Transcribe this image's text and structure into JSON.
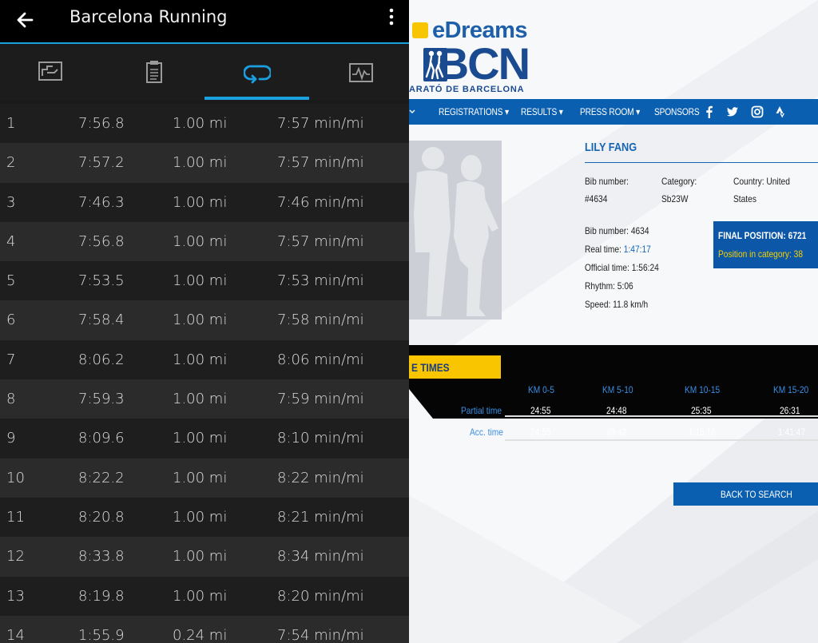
{
  "garmin": {
    "title": "Barcelona Running",
    "tabs": [
      {
        "icon": "chart-icon"
      },
      {
        "icon": "document-icon"
      },
      {
        "icon": "laps-icon",
        "selected": true
      },
      {
        "icon": "activity-graph-icon"
      }
    ],
    "laps": [
      {
        "num": "1",
        "time": "7:56.8",
        "distance": "1.00 mi",
        "pace": "7:57 min/mi"
      },
      {
        "num": "2",
        "time": "7:57.2",
        "distance": "1.00 mi",
        "pace": "7:57 min/mi"
      },
      {
        "num": "3",
        "time": "7:46.3",
        "distance": "1.00 mi",
        "pace": "7:46 min/mi"
      },
      {
        "num": "4",
        "time": "7:56.8",
        "distance": "1.00 mi",
        "pace": "7:57 min/mi"
      },
      {
        "num": "5",
        "time": "7:53.5",
        "distance": "1.00 mi",
        "pace": "7:53 min/mi"
      },
      {
        "num": "6",
        "time": "7:58.4",
        "distance": "1.00 mi",
        "pace": "7:58 min/mi"
      },
      {
        "num": "7",
        "time": "8:06.2",
        "distance": "1.00 mi",
        "pace": "8:06 min/mi"
      },
      {
        "num": "8",
        "time": "7:59.3",
        "distance": "1.00 mi",
        "pace": "7:59 min/mi"
      },
      {
        "num": "9",
        "time": "8:09.6",
        "distance": "1.00 mi",
        "pace": "8:10 min/mi"
      },
      {
        "num": "10",
        "time": "8:22.2",
        "distance": "1.00 mi",
        "pace": "8:22 min/mi"
      },
      {
        "num": "11",
        "time": "8:20.8",
        "distance": "1.00 mi",
        "pace": "8:21 min/mi"
      },
      {
        "num": "12",
        "time": "8:33.8",
        "distance": "1.00 mi",
        "pace": "8:34 min/mi"
      },
      {
        "num": "13",
        "time": "8:19.8",
        "distance": "1.00 mi",
        "pace": "8:20 min/mi"
      },
      {
        "num": "14",
        "time": "1:55.9",
        "distance": "0.24 mi",
        "pace": "7:54 min/mi"
      }
    ],
    "colors": {
      "accent": "#1aa0e0"
    }
  },
  "results": {
    "brand": "eDreams",
    "logo": "BCN",
    "logo_sub": "ARATÓ DE BARCELONA",
    "nav": [
      "REGISTRATIONS",
      "RESULTS",
      "PRESS ROOM",
      "SPONSORS"
    ],
    "runner": {
      "name": "LILY FANG",
      "bib_label": "Bib number:",
      "bib_value": "#4634",
      "category_label": "Category:",
      "category_value": "Sb23W",
      "country_line1": "Country: United",
      "country_line2": "States",
      "bib_number_line": "Bib number: 4634",
      "real_time_label": "Real time:",
      "real_time": "1:47:17",
      "official_time": "Official time: 1:56:24",
      "rhythm": "Rhythm: 5:06",
      "speed": "Speed: 11.8 km/h"
    },
    "final_position": "FINAL POSITION: 6721",
    "category_position": "Position in category: 38",
    "times_label": "E TIMES",
    "splits": {
      "headers": [
        "KM 0-5",
        "KM 5-10",
        "KM 10-15",
        "KM 15-20"
      ],
      "partial_label": "Partial time",
      "partial": [
        "24:55",
        "24:48",
        "25:35",
        "26:31"
      ],
      "acc_label": "Acc. time",
      "acc": [
        "24:55",
        "49:42",
        "1:15:16",
        "1:41:47"
      ]
    },
    "back_button": "BACK TO SEARCH",
    "colors": {
      "primary": "#0b5fb0",
      "yellow": "#f9c400"
    }
  }
}
